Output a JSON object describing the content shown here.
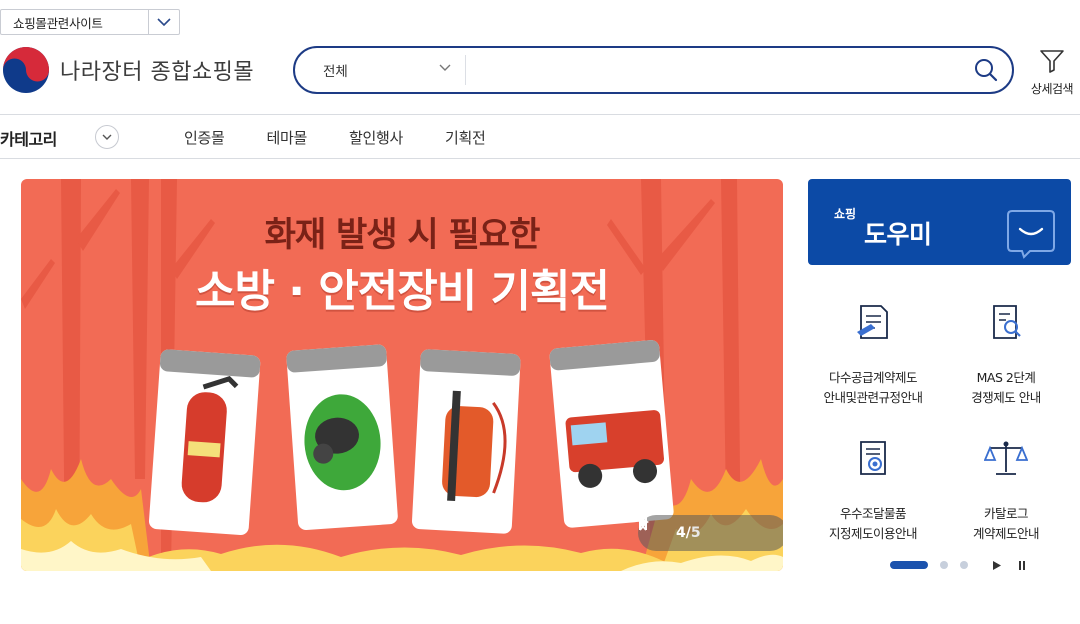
{
  "related_site": {
    "label": "쇼핑몰관련사이트"
  },
  "logo": {
    "title": "나라장터 종합쇼핑몰"
  },
  "search": {
    "scope": "전체",
    "value": "",
    "placeholder": ""
  },
  "detail_search": {
    "label": "상세검색"
  },
  "nav": {
    "category": "카테고리",
    "items": [
      {
        "label": "인증몰"
      },
      {
        "label": "테마몰"
      },
      {
        "label": "할인행사"
      },
      {
        "label": "기획전"
      }
    ]
  },
  "banner": {
    "line1": "화재 발생 시 필요한",
    "line2": "소방 · 안전장비 기획전",
    "current": "4",
    "total": "5",
    "separator": "/"
  },
  "helper": {
    "sub": "쇼핑",
    "title": "도우미",
    "items": [
      {
        "line1": "다수공급계약제도",
        "line2": "안내및관련규정안내",
        "icon": "contract-document-icon"
      },
      {
        "line1": "MAS 2단계",
        "line2": "경쟁제도 안내",
        "icon": "document-search-icon"
      },
      {
        "line1": "우수조달물품",
        "line2": "지정제도이용안내",
        "icon": "certificate-icon"
      },
      {
        "line1": "카탈로그",
        "line2": "계약제도안내",
        "icon": "scale-icon"
      }
    ],
    "pages": 3,
    "current_page": 1
  },
  "colors": {
    "brand": "#1d3b85",
    "helper_bg": "#0c4aa6",
    "banner_bg": "#f26b55"
  }
}
